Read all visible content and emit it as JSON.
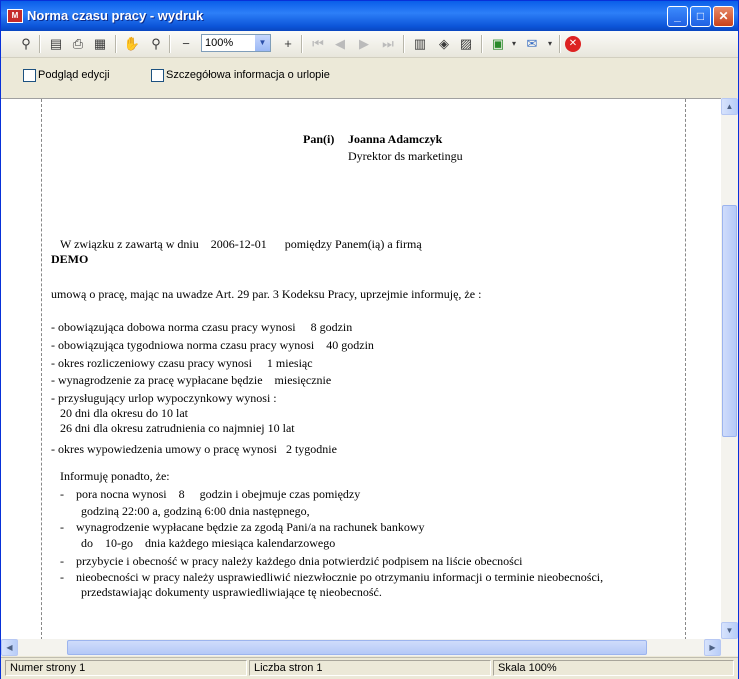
{
  "window": {
    "title": "Norma czasu pracy - wydruk",
    "app_icon_text": "M",
    "controls": {
      "minimize": "_",
      "maximize": "□",
      "close": "✕"
    }
  },
  "toolbar": {
    "zoom_value": "100%",
    "icons": [
      "binoculars-icon",
      "page-setup-icon",
      "print-icon",
      "print-setup-icon",
      "edit-icon",
      "hand-icon",
      "zoom-icon",
      "zoom-out-icon",
      "zoom-in-icon",
      "first-page-icon",
      "prev-page-icon",
      "next-page-icon",
      "last-page-icon",
      "multipage-icon",
      "background-icon",
      "watermark-icon",
      "export-icon",
      "email-icon",
      "close-preview-icon"
    ]
  },
  "options": {
    "edit_preview_label": "Podgląd edycji",
    "leave_info_label": "Szczegółowa informacja o urlopie"
  },
  "document": {
    "recipient_prefix": "Pan(i)",
    "recipient_name": "Joanna Adamczyk",
    "recipient_title": "Dyrektor ds marketingu",
    "intro_line": "W związku z zawartą w dniu    2006-12-01      pomiędzy Panem(ią) a firmą",
    "company": "DEMO",
    "contract_line": "umową o pracę, mając na uwadze Art. 29 par. 3 Kodeksu Pracy, uprzejmie informuję, że :",
    "items": [
      "- obowiązująca dobowa norma czasu pracy wynosi     8 godzin",
      "- obowiązująca tygodniowa norma czasu pracy wynosi    40 godzin",
      "- okres rozliczeniowy czasu pracy wynosi     1 miesiąc",
      "- wynagrodzenie za pracę wypłacane będzie    miesięcznie",
      "- przysługujący urlop wypoczynkowy wynosi :",
      "   20 dni dla okresu do 10 lat",
      "   26 dni dla okresu zatrudnienia co najmniej 10 lat",
      "- okres wypowiedzenia umowy o pracę wynosi   2 tygodnie"
    ],
    "additional_heading": "Informuję ponadto, że:",
    "additional_items": [
      "-    pora nocna wynosi    8     godzin i obejmuje czas pomiędzy",
      "       godziną 22:00 a, godziną 6:00 dnia następnego,",
      "-    wynagrodzenie wypłacane będzie za zgodą Pani/a na rachunek bankowy",
      "       do    10-go    dnia każdego miesiąca kalendarzowego",
      "-    przybycie i obecność w pracy należy każdego dnia potwierdzić podpisem na liście obecności",
      "-    nieobecności w pracy należy usprawiedliwić niezwłocznie po otrzymaniu informacji o terminie nieobecności,",
      "       przedstawiając dokumenty usprawiedliwiające tę nieobecność."
    ]
  },
  "status": {
    "page_number": "Numer strony 1",
    "page_count": "Liczba stron 1",
    "scale": "Skala 100%"
  }
}
